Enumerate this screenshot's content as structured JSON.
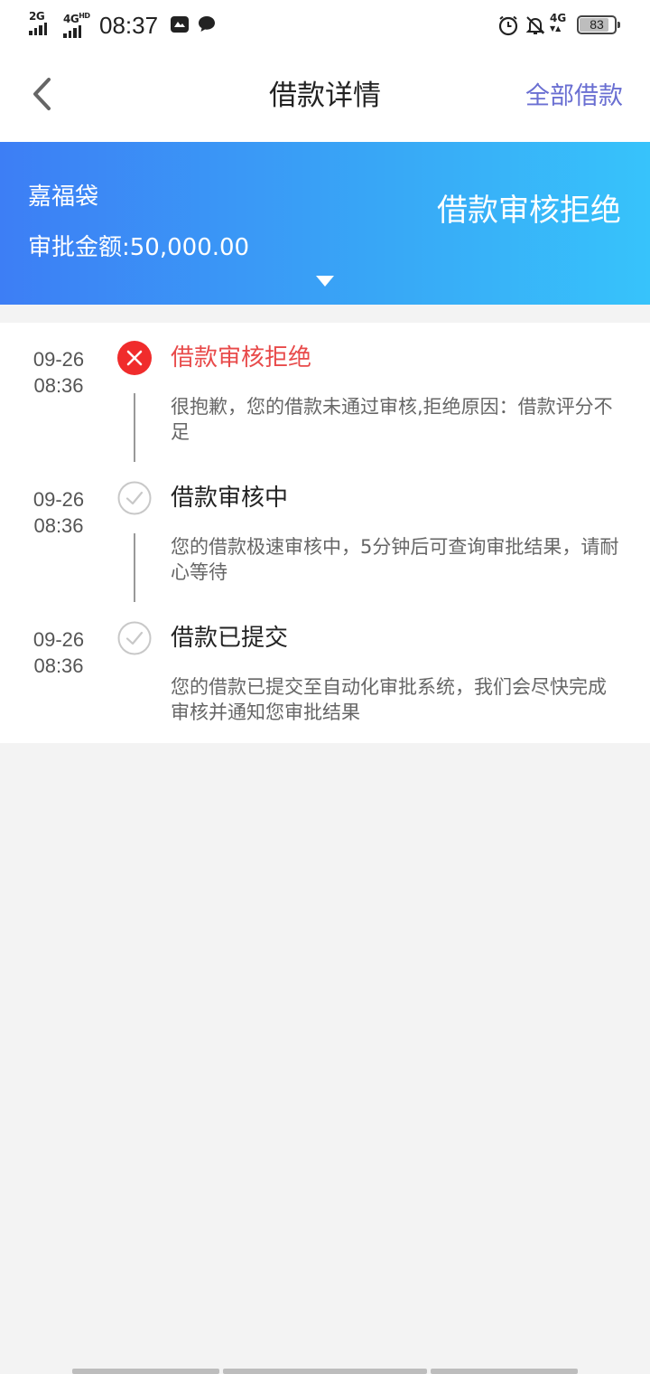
{
  "status_bar": {
    "network1": "2G",
    "network2": "4G",
    "network2_sup": "HD",
    "time": "08:37",
    "network3": "4G",
    "battery": "83"
  },
  "nav": {
    "title": "借款详情",
    "right_link": "全部借款"
  },
  "banner": {
    "product_name": "嘉福袋",
    "amount_text": "审批金额:50,000.00",
    "status": "借款审核拒绝"
  },
  "timeline": [
    {
      "date": "09-26",
      "time": "08:36",
      "title": "借款审核拒绝",
      "desc": "很抱歉，您的借款未通过审核,拒绝原因：借款评分不足",
      "status": "rejected",
      "icon": "x-circle-icon"
    },
    {
      "date": "09-26",
      "time": "08:36",
      "title": "借款审核中",
      "desc": "您的借款极速审核中，5分钟后可查询审批结果，请耐心等待",
      "status": "done",
      "icon": "check-circle-icon"
    },
    {
      "date": "09-26",
      "time": "08:36",
      "title": "借款已提交",
      "desc": "您的借款已提交至自动化审批系统，我们会尽快完成审核并通知您审批结果",
      "status": "done",
      "icon": "check-circle-icon"
    }
  ],
  "colors": {
    "accent_link": "#6a6fd2",
    "banner_start": "#3d7ef5",
    "banner_end": "#37c3fb",
    "rejected": "#e84a4a"
  }
}
